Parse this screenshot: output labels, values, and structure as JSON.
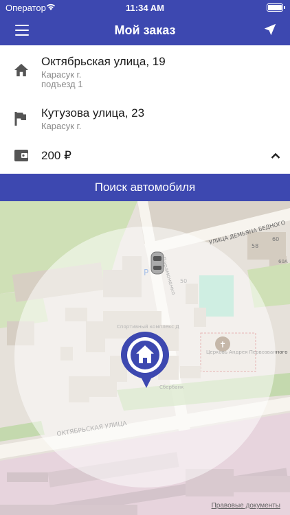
{
  "status_bar": {
    "carrier": "Оператор",
    "time": "11:34 AM"
  },
  "header": {
    "title": "Мой заказ",
    "menu_icon": "hamburger-menu-icon",
    "location_icon": "navigation-arrow-icon"
  },
  "order": {
    "pickup": {
      "street": "Октябрьская улица, 19",
      "city": "Карасук г.",
      "entrance": "подъезд 1",
      "icon": "home-icon"
    },
    "destination": {
      "street": "Кутузова улица, 23",
      "city": "Карасук г.",
      "icon": "flag-icon"
    },
    "price": {
      "amount": "200 ₽",
      "icon": "wallet-icon",
      "toggle_icon": "chevron-up-icon"
    }
  },
  "search_button": {
    "label": "Поиск автомобиля"
  },
  "map": {
    "labels": {
      "street_top": "УЛИЦА ДЕМЬЯНА БЕДНОГО",
      "street_vertical": "Парамоненко",
      "street_bottom": "ОКТЯБРЬСКАЯ УЛИЦА",
      "sport": "Спортивный комплекс Д",
      "church": "Церковь Андрея Первозванного",
      "bank": "Сбербанк",
      "num_50": "50",
      "num_58": "58",
      "num_60": "60",
      "num_60a": "60А",
      "parking": "P"
    },
    "legal_link": "Правовые документы",
    "pin_icon": "home-pin-icon",
    "car_icon": "car-icon"
  }
}
